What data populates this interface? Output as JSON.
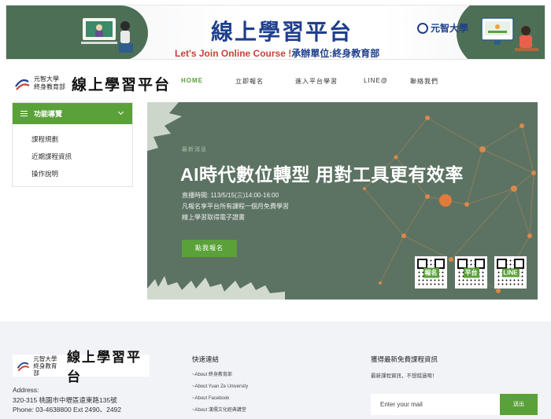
{
  "banner": {
    "title": "線上學習平台",
    "subtitle": "Let's Join Online Course !",
    "organizer": "承辦單位:終身教育部",
    "university_seal": "元智大學"
  },
  "header": {
    "logo": {
      "university": "元智大學",
      "department": "終身教育部",
      "platform": "線上學習平台"
    },
    "nav": [
      {
        "label": "HOME",
        "active": true
      },
      {
        "label": "立即報名"
      },
      {
        "label": "進入平台學習"
      },
      {
        "label": "LINE@"
      },
      {
        "label": "聯絡我們"
      }
    ]
  },
  "sidebar": {
    "title": "功能導覽",
    "items": [
      "課程規劃",
      "近期課程資訊",
      "操作說明"
    ]
  },
  "hero": {
    "tag": "最新消息",
    "headline": "AI時代數位轉型 用對工具更有效率",
    "lines": [
      "直播時間: 113/5/15(三)14:00-16:00",
      "凡報名享平台所有課程一個月免費學習",
      "線上學習取得電子證書"
    ],
    "cta": "點我報名",
    "qr_labels": [
      "報名",
      "平台",
      "LINE"
    ]
  },
  "footer": {
    "logo": {
      "university": "元智大學",
      "department": "終身教育部",
      "platform": "線上學習平台"
    },
    "address_label": "Address:",
    "address": "320-315 桃園市中壢區遠東路135號",
    "phone": "Phone: 03-4638800 Ext 2490、2492",
    "quick_links_title": "快速連結",
    "quick_links": [
      "~About 終身教育部",
      "~About Yuan Ze University",
      "~About Facebook",
      "~About 漢儒文化經典講堂"
    ],
    "newsletter_title": "獲得最新免費課程資訊",
    "newsletter_note": "最新課程資訊，不想錯過唷！",
    "email_placeholder": "Enter your mail",
    "send_label": "送出"
  },
  "colors": {
    "accent_green": "#5ba13a",
    "hero_bg": "#5c7363",
    "banner_title": "#1f3f8c",
    "banner_subtitle": "#c8423a"
  }
}
